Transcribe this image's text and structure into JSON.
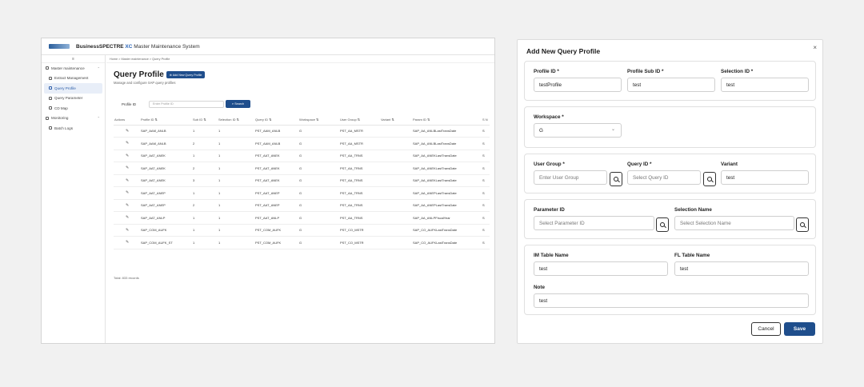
{
  "app": {
    "brand_name": "BusinessSPECTRE",
    "brand_xc": "XC",
    "brand_rest": "Master Maintenance System",
    "sidebar_top": "≡",
    "sidebar": [
      {
        "label": "Master maintenance",
        "type": "group"
      },
      {
        "label": "Extract Management",
        "type": "sub"
      },
      {
        "label": "Query Profile",
        "type": "sub",
        "active": true
      },
      {
        "label": "Query Parameter",
        "type": "sub"
      },
      {
        "label": "CD Map",
        "type": "sub"
      },
      {
        "label": "Monitoring",
        "type": "group"
      },
      {
        "label": "Batch Logs",
        "type": "sub"
      }
    ],
    "breadcrumb": "Home  >  Master maintenance  >  Query Profile",
    "page_title": "Query Profile",
    "add_button": "Add New Query Profile",
    "page_subtitle": "Manage and configure SAP query profiles",
    "filter_label": "Profile ID",
    "filter_placeholder": "Enter Profile ID",
    "search_button": "Search",
    "columns": [
      "Actions",
      "Profile ID ⇅",
      "Sub ID ⇅",
      "Selection ID ⇅",
      "Query ID ⇅",
      "Workspace ⇅",
      "User Group ⇅",
      "Variant ⇅",
      "Param ID ⇅",
      "S N"
    ],
    "rows": [
      [
        "SAP_AAM_ANLB",
        "1",
        "1",
        "PST_AAM_ANLB",
        "G",
        "PST_AA_MSTR",
        "",
        "SAP_AA_ANLBLastTransDate",
        "S"
      ],
      [
        "SAP_AAM_ANLB",
        "2",
        "1",
        "PST_AAM_ANLB",
        "G",
        "PST_AA_MSTR",
        "",
        "SAP_AA_ANLBLastTransDate",
        "S"
      ],
      [
        "SAP_AAT_ANEK",
        "1",
        "1",
        "PST_AAT_ANEK",
        "G",
        "PST_AA_TRNS",
        "",
        "SAP_AA_ANEKLastTransDate",
        "S"
      ],
      [
        "SAP_AAT_ANEK",
        "2",
        "1",
        "PST_AAT_ANEK",
        "G",
        "PST_AA_TRNS",
        "",
        "SAP_AA_ANEKLastTransDate",
        "S"
      ],
      [
        "SAP_AAT_ANEK",
        "3",
        "1",
        "PST_AAT_ANEK",
        "G",
        "PST_AA_TRNS",
        "",
        "SAP_AA_ANEKLastTransDate",
        "S"
      ],
      [
        "SAP_AAT_ANEP",
        "1",
        "1",
        "PST_AAT_ANEP",
        "G",
        "PST_AA_TRNS",
        "",
        "SAP_AA_ANEPLastTransDate",
        "S"
      ],
      [
        "SAP_AAT_ANEP",
        "2",
        "1",
        "PST_AAT_ANEP",
        "G",
        "PST_AA_TRNS",
        "",
        "SAP_AA_ANEPLastTransDate",
        "S"
      ],
      [
        "SAP_AAT_ANLP",
        "1",
        "1",
        "PST_AAT_ANLP",
        "G",
        "PST_AA_TRNS",
        "",
        "SAP_AA_ANLPFiscalYear",
        "S"
      ],
      [
        "SAP_COM_AUFK",
        "1",
        "1",
        "PST_COM_AUFK",
        "G",
        "PST_CO_MSTR",
        "",
        "SAP_CO_AUFKLastTransDate",
        "S"
      ],
      [
        "SAP_COM_AUFK_ST",
        "1",
        "1",
        "PST_COM_AUFK",
        "G",
        "PST_CO_MSTR",
        "",
        "SAP_CO_AUFKLastTransDate",
        "S"
      ]
    ],
    "total": "Total: 833 records"
  },
  "modal": {
    "title": "Add New Query Profile",
    "close": "×",
    "profile_id_label": "Profile ID *",
    "profile_id_value": "testProfile",
    "profile_sub_id_label": "Profile Sub ID *",
    "profile_sub_id_value": "test",
    "selection_id_label": "Selection ID *",
    "selection_id_value": "test",
    "workspace_label": "Workspace *",
    "workspace_value": "G",
    "user_group_label": "User Group *",
    "user_group_placeholder": "Enter User Group",
    "query_id_label": "Query ID *",
    "query_id_placeholder": "Select Query ID",
    "variant_label": "Variant",
    "variant_value": "test",
    "parameter_id_label": "Parameter ID",
    "parameter_id_placeholder": "Select Parameter ID",
    "selection_name_label": "Selection Name",
    "selection_name_placeholder": "Select Selection Name",
    "im_table_label": "IM Table Name",
    "im_table_value": "test",
    "fl_table_label": "FL Table Name",
    "fl_table_value": "test",
    "note_label": "Note",
    "note_value": "test",
    "cancel": "Cancel",
    "save": "Save"
  }
}
